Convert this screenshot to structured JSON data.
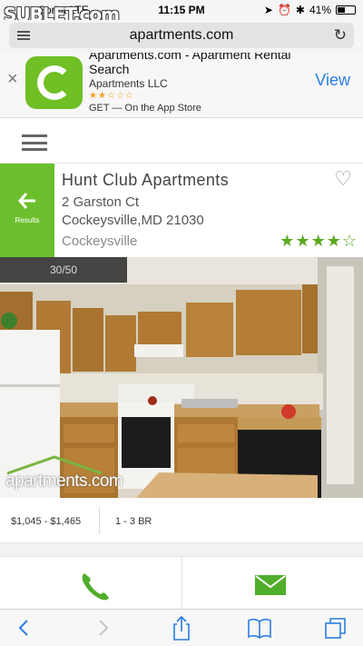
{
  "status_bar": {
    "carrier": "Sprint  LTE",
    "time": "11:15 PM",
    "battery": "41%",
    "watermark": "SUBLET.com"
  },
  "browser": {
    "url": "apartments.com"
  },
  "app_banner": {
    "title": "Apartments.com - Apartment Rental Search",
    "developer": "Apartments LLC",
    "stars": "★★☆☆☆",
    "get_text": "GET — On the App Store",
    "view_label": "View",
    "close_label": "×"
  },
  "listing": {
    "back_label": "Results",
    "name": "Hunt Club Apartments",
    "address_line1": "2 Garston Ct",
    "address_line2": "Cockeysville,MD 21030",
    "neighborhood": "Cockeysville",
    "rating": 4,
    "rating_max": 5
  },
  "photo": {
    "counter": "30/50",
    "watermark": "apartments.com"
  },
  "summary": {
    "price": "$1,045 - $1,465",
    "beds": "1 - 3 BR"
  },
  "colors": {
    "brand_green": "#6cbf2c",
    "link_blue": "#2b7de1",
    "icon_blue": "#2b7de1"
  },
  "icons": {
    "back": "arrow-left-icon",
    "favorite": "heart-outline-icon",
    "phone": "phone-icon",
    "email": "envelope-icon"
  }
}
